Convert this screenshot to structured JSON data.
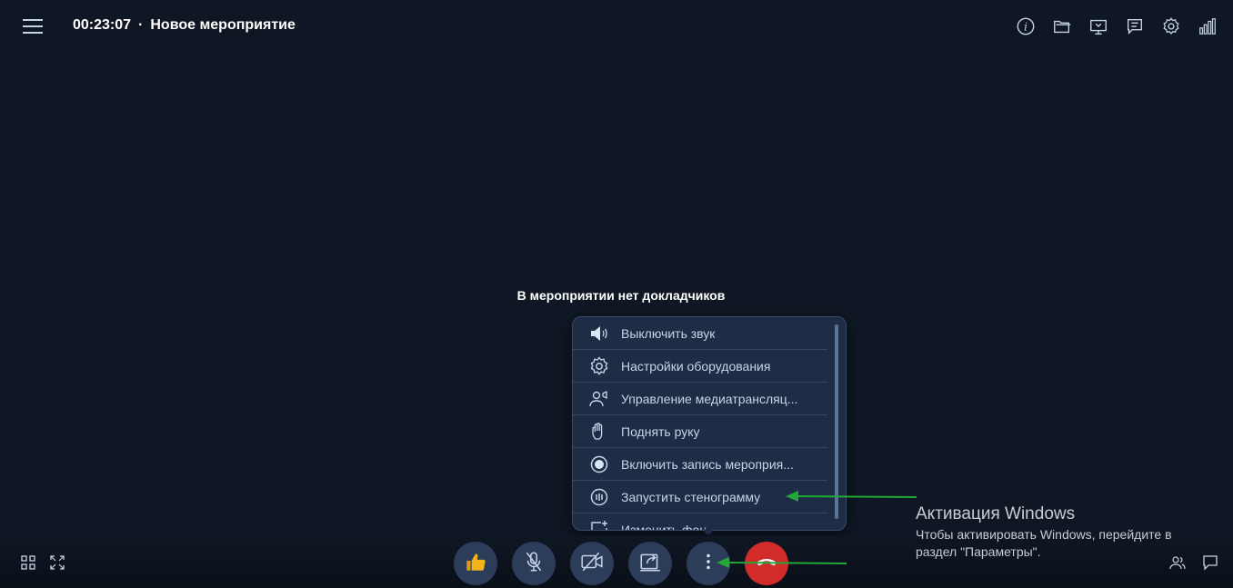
{
  "header": {
    "timer": "00:23:07",
    "separator": "·",
    "title": "Новое мероприятие",
    "icons": [
      "info-icon",
      "folder-icon",
      "screen-share-icon",
      "chat-icon",
      "gear-icon",
      "signal-icon"
    ]
  },
  "main": {
    "status_text": "В мероприятии нет докладчиков"
  },
  "context_menu": {
    "items": [
      {
        "label": "Выключить звук",
        "icon": "speaker-icon"
      },
      {
        "label": "Настройки оборудования",
        "icon": "gear-icon"
      },
      {
        "label": "Управление медиатрансляц...",
        "icon": "broadcast-icon"
      },
      {
        "label": "Поднять руку",
        "icon": "hand-icon"
      },
      {
        "label": "Включить запись мероприя...",
        "icon": "record-icon"
      },
      {
        "label": "Запустить стенограмму",
        "icon": "transcript-icon"
      },
      {
        "label": "Изменить фон",
        "icon": "background-icon"
      }
    ]
  },
  "toolbar": {
    "buttons": [
      "like-button",
      "mute-mic-button",
      "camera-off-button",
      "share-button",
      "more-button",
      "hangup-button"
    ],
    "colors": {
      "button": "#2c3d5a",
      "hangup": "#d32a2a",
      "like": "#f2b418"
    }
  },
  "windows_activation": {
    "title": "Активация Windows",
    "text": "Чтобы активировать Windows, перейдите в раздел \"Параметры\"."
  },
  "annotations": {
    "arrow_color": "#21a837"
  }
}
